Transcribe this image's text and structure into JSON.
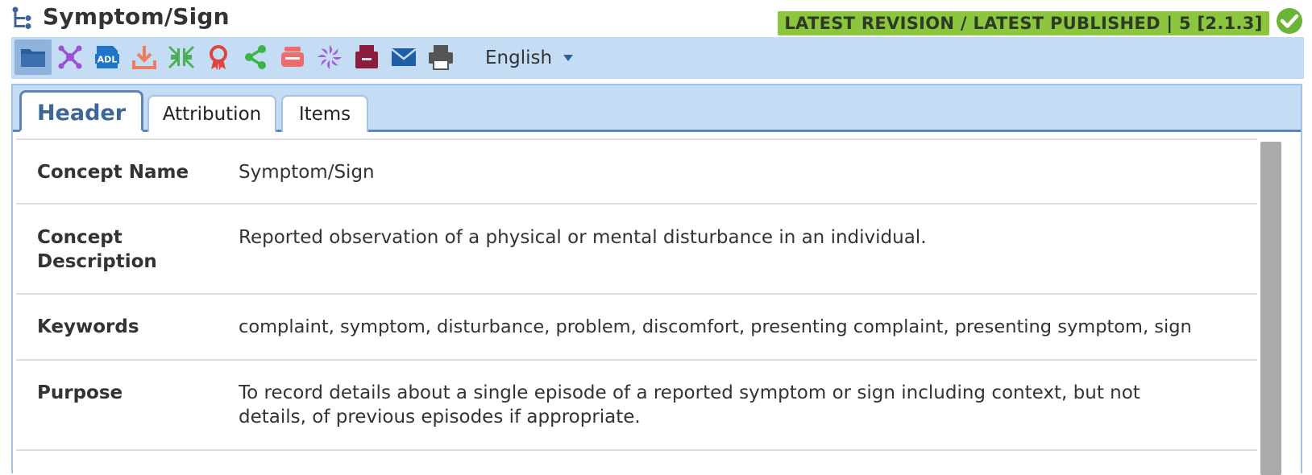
{
  "header": {
    "title": "Symptom/Sign",
    "status": "LATEST REVISION / LATEST PUBLISHED | 5 [2.1.3]"
  },
  "toolbar": {
    "language": "English",
    "icons": [
      "folder-icon",
      "mindmap-icon",
      "adl-icon",
      "download-icon",
      "compress-icon",
      "award-icon",
      "share-icon",
      "printer-stack-icon",
      "spinner-icon",
      "archive-icon",
      "email-icon",
      "print-icon"
    ]
  },
  "tabs": [
    {
      "label": "Header"
    },
    {
      "label": "Attribution"
    },
    {
      "label": "Items"
    }
  ],
  "rows": [
    {
      "label": "Concept Name",
      "value": "Symptom/Sign"
    },
    {
      "label": "Concept Description",
      "value": "Reported observation of a physical or mental disturbance in an individual."
    },
    {
      "label": "Keywords",
      "value": "complaint, symptom, disturbance, problem, discomfort, presenting complaint, presenting symptom, sign"
    },
    {
      "label": "Purpose",
      "value": "To record details about a single episode of a reported symptom or sign including context, but not details, of previous episodes if appropriate."
    }
  ],
  "colors": {
    "badge": "#8cc63f",
    "toolbar": "#c5ddf4",
    "active_tab_text": "#3f6597"
  }
}
